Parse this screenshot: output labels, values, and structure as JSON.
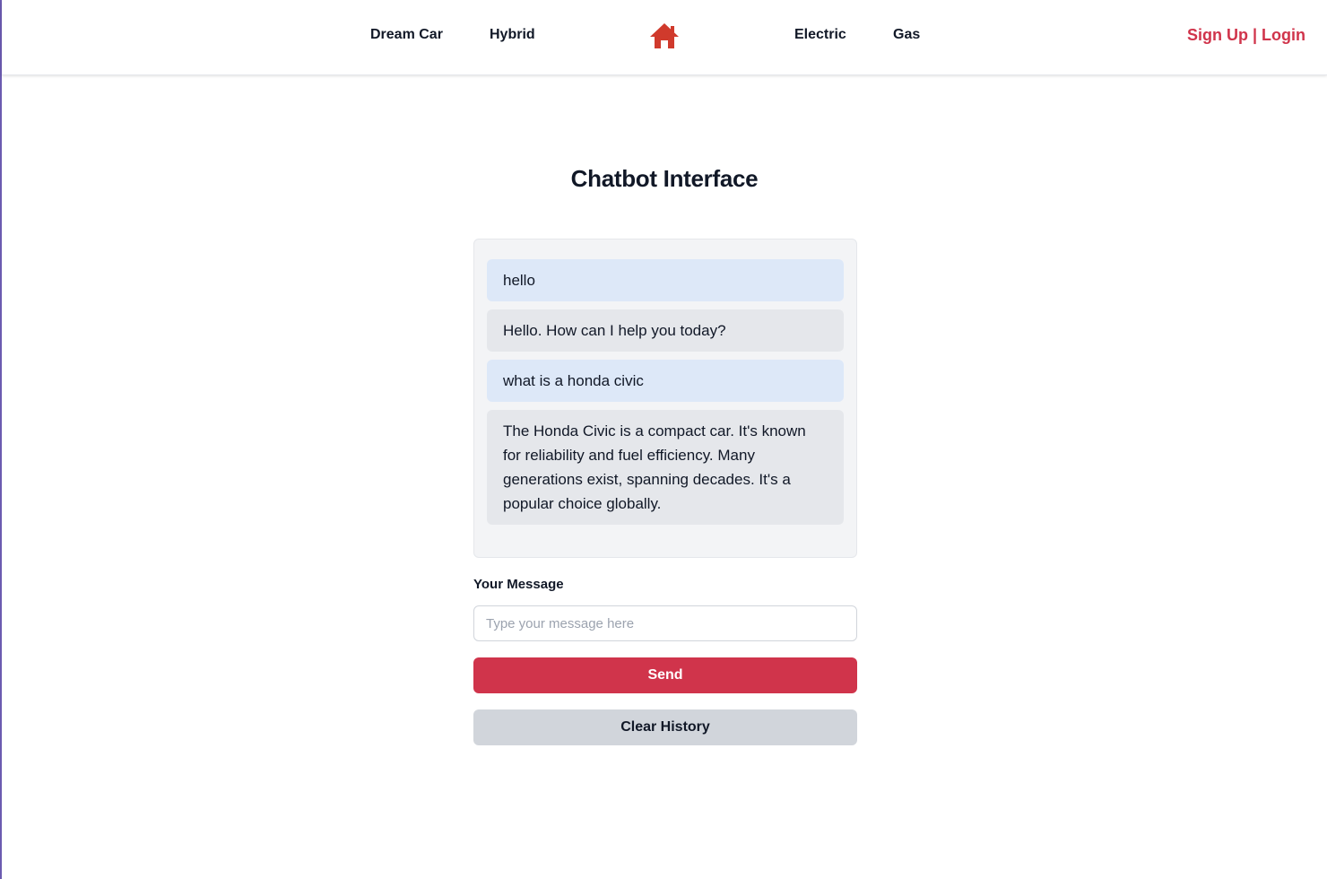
{
  "nav": {
    "links": [
      "Dream Car",
      "Hybrid",
      "Electric",
      "Gas"
    ],
    "home_icon": "home-icon",
    "signup": "Sign Up",
    "separator": " | ",
    "login": "Login"
  },
  "page": {
    "title": "Chatbot Interface"
  },
  "chat": {
    "messages": [
      {
        "role": "user",
        "text": "hello"
      },
      {
        "role": "bot",
        "text": "Hello. How can I help you today?"
      },
      {
        "role": "user",
        "text": "what is a honda civic"
      },
      {
        "role": "bot",
        "text": "The Honda Civic is a compact car. It's known for reliability and fuel efficiency. Many generations exist, spanning decades. It's a popular choice globally."
      }
    ]
  },
  "form": {
    "label": "Your Message",
    "placeholder": "Type your message here",
    "value": "",
    "send_label": "Send",
    "clear_label": "Clear History"
  },
  "colors": {
    "accent": "#d0344b",
    "user_bubble": "#dde8f8",
    "bot_bubble": "#e5e7eb",
    "home_icon": "#d03a2c"
  }
}
